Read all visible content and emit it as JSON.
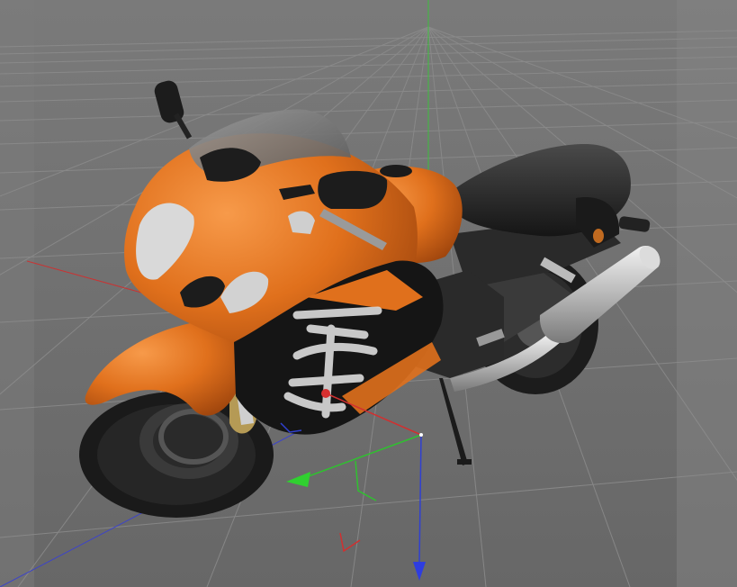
{
  "viewport": {
    "background": "#6f6f6f",
    "grid_color": "#8c8c8c",
    "axis_colors": {
      "x": "#d03030",
      "y": "#30c030",
      "z": "#2030d0"
    }
  },
  "model": {
    "body_color": "#e0701c",
    "fairing_dark": "#1a1a1a",
    "seat_color": "#232323",
    "exhaust_color": "#c8c8c8",
    "tire_color": "#1c1c1c",
    "brake_caliper_color": "#b59a55",
    "decal_color": "#d8d8d8"
  },
  "gizmo": {
    "x_handle": "x-axis-handle",
    "y_handle": "y-axis-handle",
    "z_handle": "z-axis-handle"
  }
}
